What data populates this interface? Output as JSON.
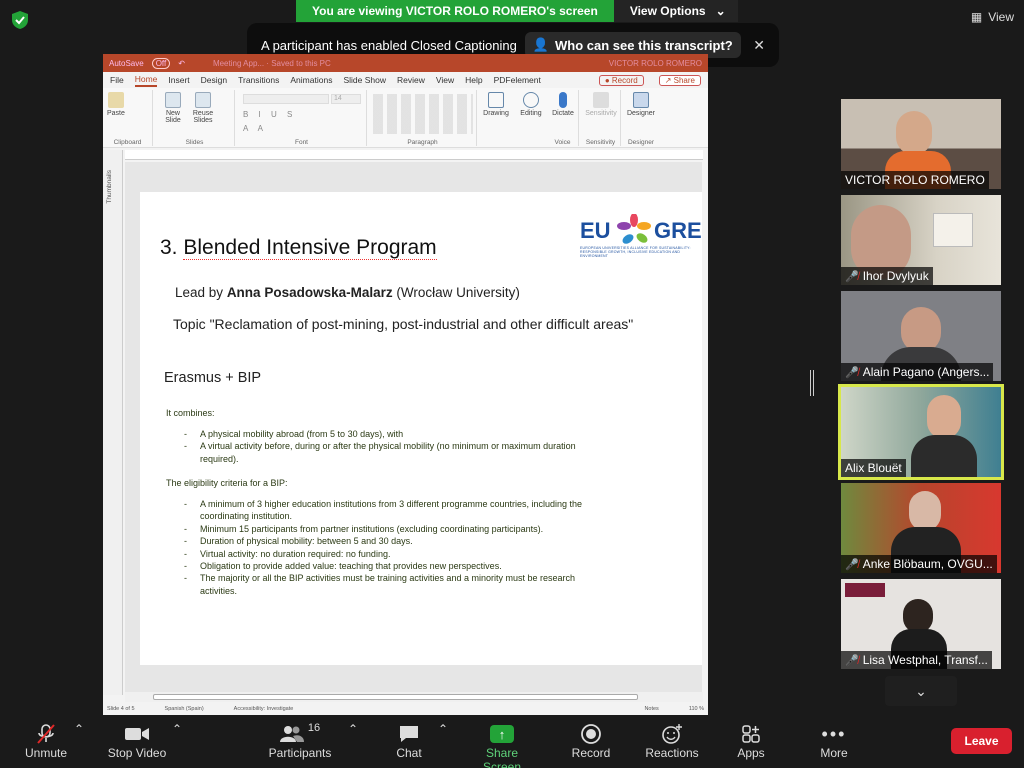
{
  "banner": {
    "viewing": "You are viewing VICTOR ROLO ROMERO's screen",
    "view_options": "View Options"
  },
  "view_btn": "View",
  "captions": {
    "message": "A participant has enabled Closed Captioning",
    "who": "Who can see this transcript?"
  },
  "ppt": {
    "titlebar": {
      "autosave": "AutoSave",
      "autosave_state": "Off",
      "doc": "Meeting App... · Saved to this PC",
      "user": "VICTOR ROLO ROMERO"
    },
    "menu": [
      "File",
      "Home",
      "Insert",
      "Design",
      "Transitions",
      "Animations",
      "Slide Show",
      "Review",
      "View",
      "Help",
      "PDFelement"
    ],
    "record": "Record",
    "share": "Share",
    "ribbon": {
      "groups": [
        "Clipboard",
        "Slides",
        "Font",
        "Paragraph",
        "Voice",
        "Sensitivity",
        "Designer"
      ],
      "buttons": {
        "paste": "Paste",
        "new_slide": "New Slide",
        "reuse": "Reuse Slides",
        "drawing": "Drawing",
        "editing": "Editing",
        "dictate": "Dictate",
        "sensitivity": "Sensitivity",
        "designer": "Designer"
      },
      "font_size": "14"
    },
    "thumbnails_label": "Thumbnails",
    "status": {
      "slide": "Slide 4 of 5",
      "lang": "Spanish (Spain)",
      "access": "Accessibility: Investigate",
      "notes": "Notes",
      "zoom": "110 %"
    }
  },
  "slide": {
    "title_num": "3.",
    "title": "Blended Intensive Program",
    "logo_eu": "EU",
    "logo_gre": "GRE",
    "logo_tag": "EUROPEAN UNIVERSITIES ALLIANCE FOR SUSTAINABILITY: RESPONSIBLE GROWTH, INCLUSIVE EDUCATION AND ENVIRONMENT",
    "lead_pre": "Lead by",
    "lead_name": "Anna Posadowska-Malarz",
    "lead_post": "(Wrocław University)",
    "topic": "Topic \"Reclamation of post-mining, post-industrial and other difficult areas\"",
    "erasmus": "Erasmus + BIP",
    "combines_head": "It combines:",
    "combines": [
      "A physical mobility abroad (from 5 to 30 days), with",
      "A virtual activity before, during or after the physical mobility (no minimum or maximum duration required)."
    ],
    "criteria_head": "The eligibility criteria for a BIP:",
    "criteria": [
      "A minimum of 3 higher education institutions from 3 different programme countries, including the coordinating institution.",
      "Minimum 15 participants from partner institutions (excluding coordinating participants).",
      "Duration of physical mobility: between 5 and 30 days.",
      "Virtual activity: no duration required: no funding.",
      "Obligation to provide added value: teaching that provides new perspectives.",
      "The majority or all the BIP activities must be training activities and a minority must be research activities."
    ]
  },
  "participants": [
    {
      "name": "VICTOR ROLO ROMERO",
      "muted": false,
      "bg": "#6b6460"
    },
    {
      "name": "Ihor Dvylyuk",
      "muted": true,
      "bg": "#8a8470"
    },
    {
      "name": "Alain Pagano (Angers...",
      "muted": true,
      "bg": "#7b7c80"
    },
    {
      "name": "Alix Blouët",
      "muted": false,
      "bg": "#6a7d70"
    },
    {
      "name": "Anke Blöbaum, OVGU...",
      "muted": true,
      "bg": "#5e6a48"
    },
    {
      "name": "Lisa Westphal, Transf...",
      "muted": true,
      "bg": "#c9c5c2"
    }
  ],
  "toolbar": {
    "unmute": "Unmute",
    "stop_video": "Stop Video",
    "participants": "Participants",
    "participants_count": "16",
    "chat": "Chat",
    "share_screen": "Share Screen",
    "record": "Record",
    "reactions": "Reactions",
    "apps": "Apps",
    "more": "More",
    "leave": "Leave"
  }
}
